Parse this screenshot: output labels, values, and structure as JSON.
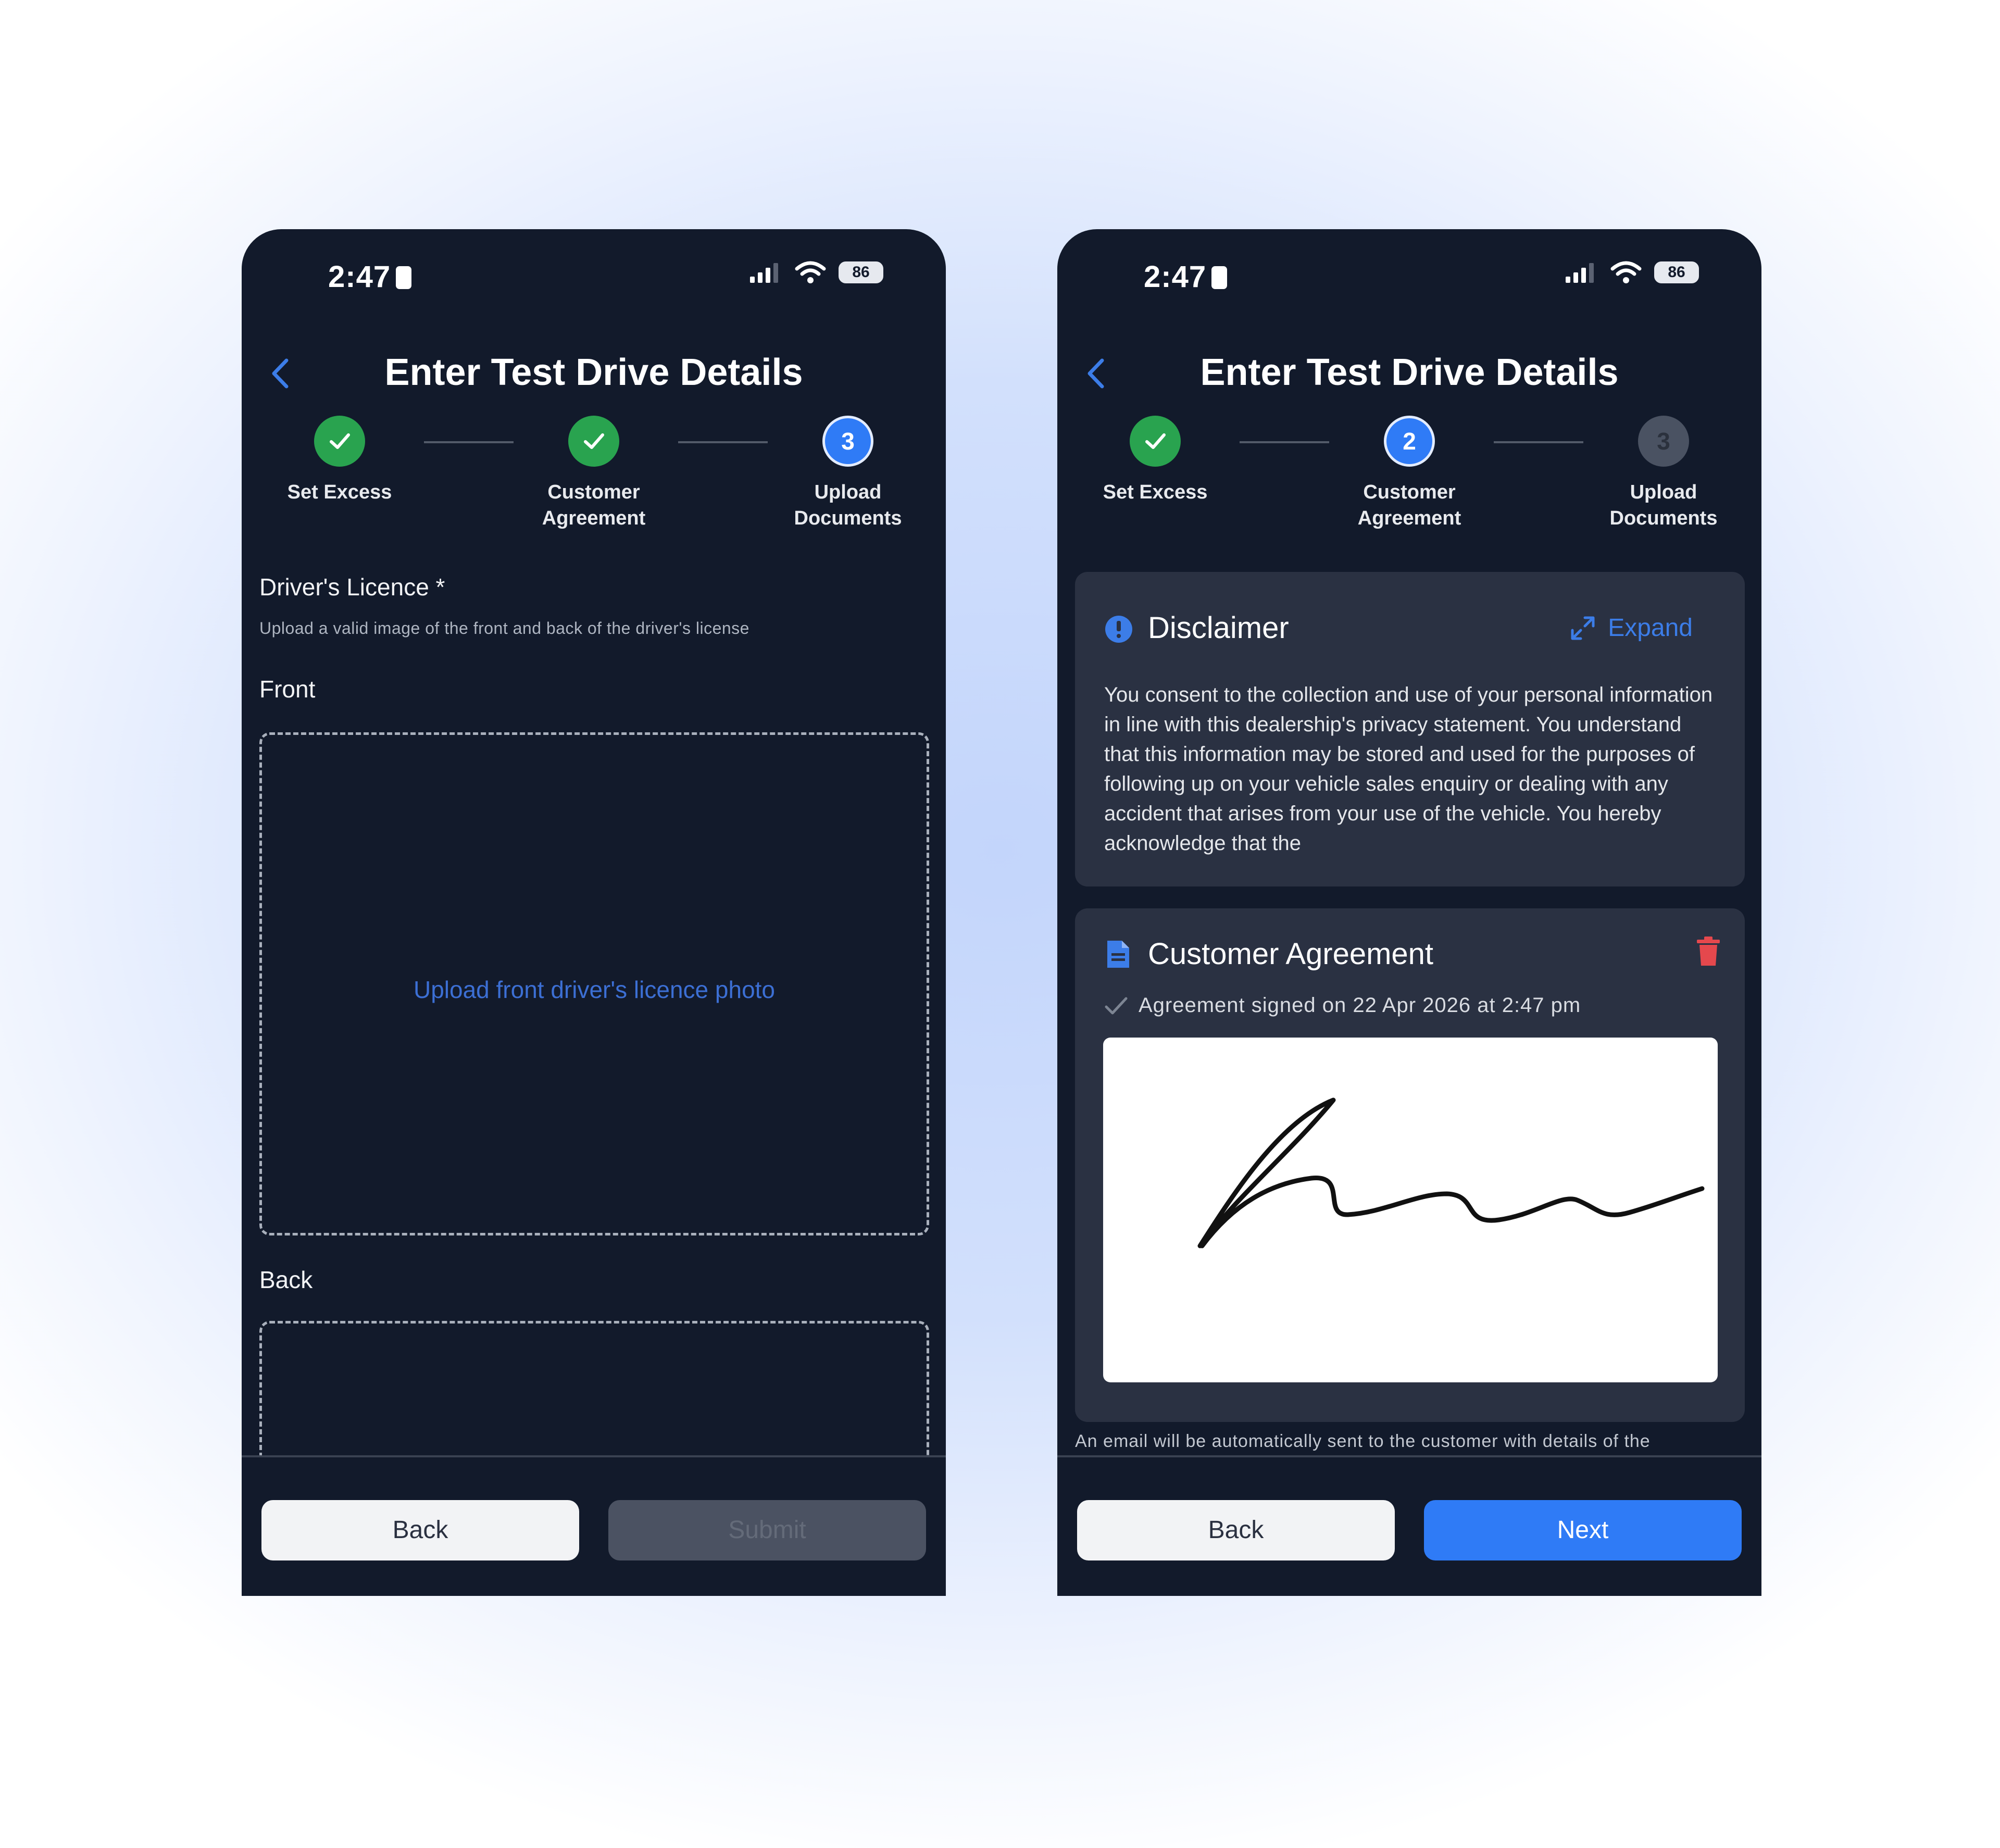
{
  "colors": {
    "accent": "#2f7bf6",
    "success": "#29a34f",
    "danger": "#e5484d",
    "phone_bg": "#121a2b",
    "card_bg": "#2a3142"
  },
  "left_screen": {
    "status_bar": {
      "time": "2:47",
      "battery": "86"
    },
    "title": "Enter Test Drive Details",
    "steps": [
      {
        "label": "Set Excess",
        "state": "done"
      },
      {
        "label": "Customer Agreement",
        "state": "done"
      },
      {
        "number": "3",
        "label": "Upload Documents",
        "state": "active"
      }
    ],
    "licence": {
      "title": "Driver's Licence *",
      "helper": "Upload a valid image of the front and back of the driver's license",
      "front_label": "Front",
      "front_upload": "Upload front driver's licence photo",
      "back_label": "Back"
    },
    "buttons": {
      "back": "Back",
      "submit": "Submit"
    }
  },
  "right_screen": {
    "status_bar": {
      "time": "2:47",
      "battery": "86"
    },
    "title": "Enter Test Drive Details",
    "steps": [
      {
        "label": "Set Excess",
        "state": "done"
      },
      {
        "number": "2",
        "label": "Customer Agreement",
        "state": "active"
      },
      {
        "number": "3",
        "label": "Upload Documents",
        "state": "pending"
      }
    ],
    "disclaimer": {
      "title": "Disclaimer",
      "expand": "Expand",
      "text": "You consent to the collection and use of your personal information in line with this dealership's privacy statement. You understand that this information may be stored and used for the purposes of following up on your vehicle sales enquiry or dealing with any accident that arises from your use of the vehicle. You hereby acknowledge that the"
    },
    "agreement": {
      "title": "Customer Agreement",
      "signed_text": "Agreement signed on 22 Apr 2026 at 2:47 pm"
    },
    "footnote": "An email will be automatically sent to the customer with details of the",
    "buttons": {
      "back": "Back",
      "next": "Next"
    }
  }
}
